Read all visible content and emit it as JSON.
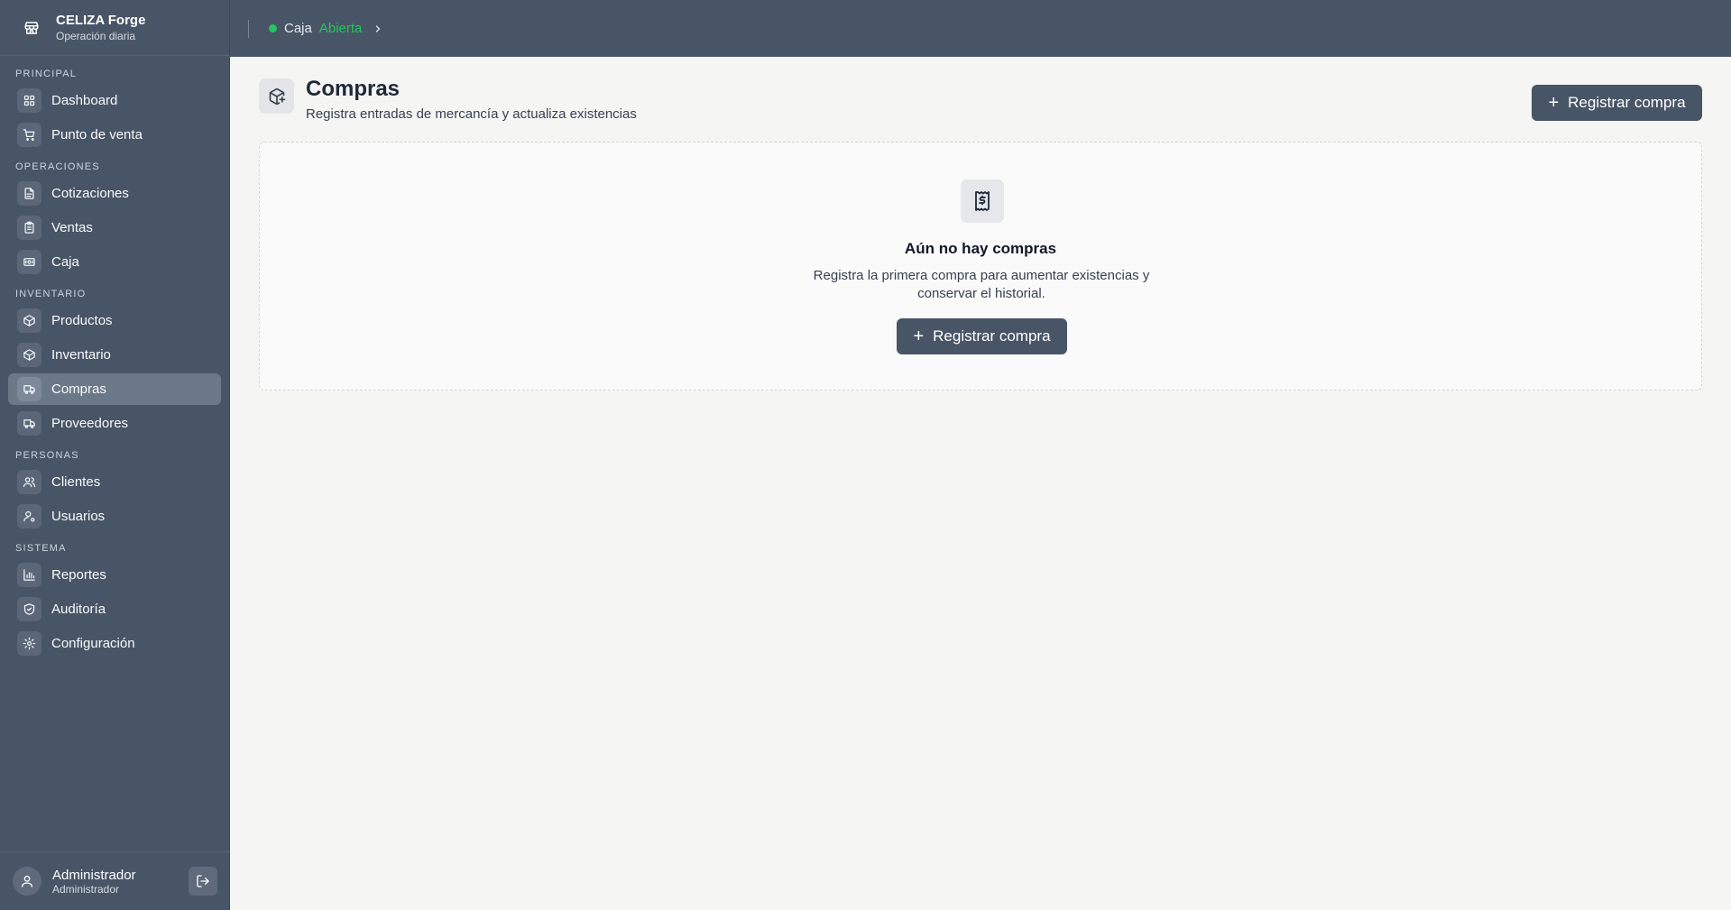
{
  "brand": {
    "title": "CELIZA Forge",
    "subtitle": "Operación diaria",
    "icon": "store-icon"
  },
  "sidebar": {
    "sections": [
      {
        "label": "PRINCIPAL",
        "items": [
          {
            "label": "Dashboard",
            "icon": "grid-icon"
          },
          {
            "label": "Punto de venta",
            "icon": "cart-icon"
          }
        ]
      },
      {
        "label": "OPERACIONES",
        "items": [
          {
            "label": "Cotizaciones",
            "icon": "document-icon"
          },
          {
            "label": "Ventas",
            "icon": "clipboard-icon"
          },
          {
            "label": "Caja",
            "icon": "cash-icon"
          }
        ]
      },
      {
        "label": "INVENTARIO",
        "items": [
          {
            "label": "Productos",
            "icon": "box-icon"
          },
          {
            "label": "Inventario",
            "icon": "box-icon"
          },
          {
            "label": "Compras",
            "icon": "truck-icon",
            "active": true
          },
          {
            "label": "Proveedores",
            "icon": "truck-icon"
          }
        ]
      },
      {
        "label": "PERSONAS",
        "items": [
          {
            "label": "Clientes",
            "icon": "users-icon"
          },
          {
            "label": "Usuarios",
            "icon": "user-cog-icon"
          }
        ]
      },
      {
        "label": "SISTEMA",
        "items": [
          {
            "label": "Reportes",
            "icon": "chart-icon"
          },
          {
            "label": "Auditoría",
            "icon": "shield-icon"
          },
          {
            "label": "Configuración",
            "icon": "gear-icon"
          }
        ]
      }
    ]
  },
  "user": {
    "name": "Administrador",
    "role": "Administrador"
  },
  "topbar": {
    "cash_label": "Caja",
    "cash_state": "Abierta",
    "status_color": "#22c55e"
  },
  "page": {
    "title": "Compras",
    "subtitle": "Registra entradas de mercancía y actualiza existencias",
    "action_label": "Registrar compra"
  },
  "empty_state": {
    "title": "Aún no hay compras",
    "description": "Registra la primera compra para aumentar existencias y conservar el historial.",
    "action_label": "Registrar compra"
  },
  "colors": {
    "sidebar_bg": "#485566",
    "accent": "#485566",
    "page_bg": "#f5f5f4"
  }
}
